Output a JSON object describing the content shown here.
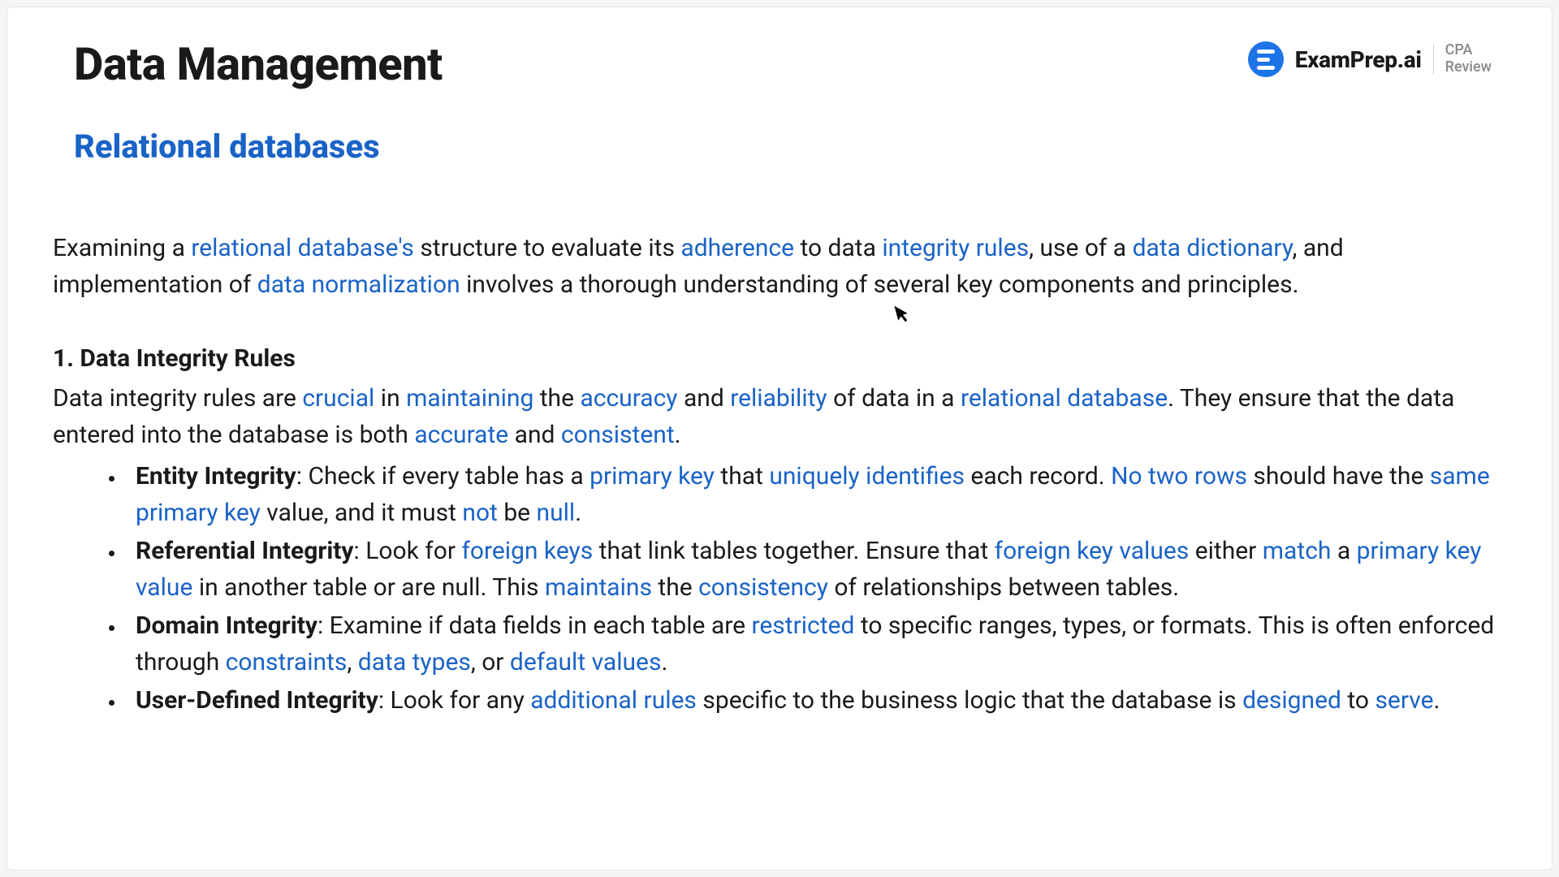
{
  "header": {
    "title": "Data Management",
    "subtitle": "Relational databases"
  },
  "brand": {
    "name": "ExamPrep.ai",
    "tagline_line1": "CPA",
    "tagline_line2": "Review"
  },
  "intro": {
    "parts": [
      {
        "t": "Examining a "
      },
      {
        "t": "relational database's",
        "hl": true
      },
      {
        "t": " structure to evaluate its "
      },
      {
        "t": "adherence",
        "hl": true
      },
      {
        "t": " to data "
      },
      {
        "t": "integrity rules",
        "hl": true
      },
      {
        "t": ", use of a "
      },
      {
        "t": "data dictionary",
        "hl": true
      },
      {
        "t": ", and implementation of "
      },
      {
        "t": "data normalization",
        "hl": true
      },
      {
        "t": " involves a thorough understanding of several key components and principles."
      }
    ]
  },
  "section": {
    "heading": "1. Data Integrity Rules",
    "lead_parts": [
      {
        "t": "Data integrity rules are "
      },
      {
        "t": "crucial",
        "hl": true
      },
      {
        "t": " in "
      },
      {
        "t": "maintaining",
        "hl": true
      },
      {
        "t": " the "
      },
      {
        "t": "accuracy",
        "hl": true
      },
      {
        "t": " and "
      },
      {
        "t": "reliability",
        "hl": true
      },
      {
        "t": " of data in a "
      },
      {
        "t": "relational database",
        "hl": true
      },
      {
        "t": ". They ensure that the data entered into the database is both "
      },
      {
        "t": "accurate",
        "hl": true
      },
      {
        "t": " and "
      },
      {
        "t": "consistent",
        "hl": true
      },
      {
        "t": "."
      }
    ],
    "bullets": [
      {
        "parts": [
          {
            "t": "Entity Integrity",
            "bold": true
          },
          {
            "t": ": Check if every table has a "
          },
          {
            "t": "primary key",
            "hl": true
          },
          {
            "t": " that "
          },
          {
            "t": "uniquely identifies",
            "hl": true
          },
          {
            "t": " each record. "
          },
          {
            "t": "No two rows",
            "hl": true
          },
          {
            "t": " should have the "
          },
          {
            "t": "same primary key",
            "hl": true
          },
          {
            "t": " value, and it must "
          },
          {
            "t": "not",
            "hl": true
          },
          {
            "t": " be "
          },
          {
            "t": "null",
            "hl": true
          },
          {
            "t": "."
          }
        ]
      },
      {
        "parts": [
          {
            "t": "Referential Integrity",
            "bold": true
          },
          {
            "t": ": Look for "
          },
          {
            "t": "foreign keys",
            "hl": true
          },
          {
            "t": " that link tables together. Ensure that "
          },
          {
            "t": "foreign key values",
            "hl": true
          },
          {
            "t": " either "
          },
          {
            "t": "match",
            "hl": true
          },
          {
            "t": " a "
          },
          {
            "t": "primary key value",
            "hl": true
          },
          {
            "t": " in another table or are null. This "
          },
          {
            "t": "maintains",
            "hl": true
          },
          {
            "t": " the "
          },
          {
            "t": "consistency",
            "hl": true
          },
          {
            "t": " of relationships between tables."
          }
        ]
      },
      {
        "parts": [
          {
            "t": "Domain Integrity",
            "bold": true
          },
          {
            "t": ": Examine if data fields in each table are "
          },
          {
            "t": "restricted",
            "hl": true
          },
          {
            "t": " to specific ranges, types, or formats. This is often enforced through "
          },
          {
            "t": "constraints",
            "hl": true
          },
          {
            "t": ", "
          },
          {
            "t": "data types",
            "hl": true
          },
          {
            "t": ", or "
          },
          {
            "t": "default values",
            "hl": true
          },
          {
            "t": "."
          }
        ]
      },
      {
        "parts": [
          {
            "t": "User-Defined Integrity",
            "bold": true
          },
          {
            "t": ": Look for any "
          },
          {
            "t": "additional rules",
            "hl": true
          },
          {
            "t": " specific to the business logic that the database is "
          },
          {
            "t": "designed",
            "hl": true
          },
          {
            "t": " to "
          },
          {
            "t": "serve",
            "hl": true
          },
          {
            "t": "."
          }
        ]
      }
    ]
  }
}
